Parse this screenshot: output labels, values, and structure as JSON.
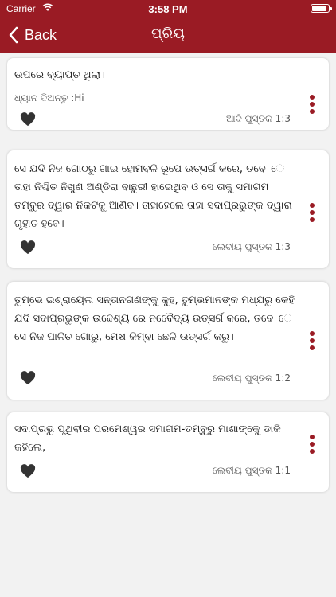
{
  "status_bar": {
    "carrier": "Carrier",
    "time": "3:58 PM"
  },
  "nav": {
    "back_label": "Back",
    "title": "ପ୍ରିୟ"
  },
  "cards": [
    {
      "text": "ଉପରେ ବ୍ୟାପ୍ତ ଥିଲା।",
      "note": "ଧ୍ୟାନ ଦିଅନ୍ତୁ :Hi",
      "ref": "ଆଦି ପୁସ୍ତକ 1:3"
    },
    {
      "text": " ସେ ଯଦି ନିଜ ଗୋଠରୁ ଗାଇ ହୋମବଳି ରୂପେ ଉତ୍ସର୍ଗ କରେ, ତବେ େ ତାହା ନିଶ୍ଚିତ ନିଖୁଣ ଅଣ୍ଡିରା ବାଛୁରୀ ହାଇେଥିବ ଓ ସେ ତାକୁ ସମାଗମ ତମ୍ବୁର ଦ୍ୱାର ନିକଟକୁ ଆଣିବ। ତାହାହେଲେ ତାହା ସଦାପ୍ରଭୁଙ୍କ ଦ୍ୱାରା ଗୃହୀତ ହବେ।",
      "ref": "ଲେବୀୟ ପୁସ୍ତକ 1:3"
    },
    {
      "text": "ତୁମ୍ଭେ ଇଶ୍ରାୟେଲ ସନ୍ତାନଗଣଙ୍କୁ କୁହ, ତୁମ୍ଭମାନଙ୍କ ମଧ୍ଯରୁ କେହି ଯଦି ସଦାପ୍ରଭୁଙ୍କ ଉଦ୍ଦେଶ୍ୟ ରେ ନବୈେଦ୍ୟ ଉତ୍ସର୍ଗ କରେ, ତବେ େ ସେ ନିଜ ପାଳିତ ଗୋରୁ, ମେଷ କିମ୍ବା ଛେଳି ଉତ୍ସର୍ଗ କରୁ।",
      "ref": "ଲେବୀୟ ପୁସ୍ତକ 1:2"
    },
    {
      "text": "ସଦାପ୍ରଭୁ ପୃଥିବୀର ପରମେଶ୍ୱର ସମାଗମ-ତମ୍ବୁରୁ ମାଶାଙ୍କେୁ ଡାକି କହିଲେ,",
      "ref": "ଲେବୀୟ ପୁସ୍ତକ 1:1"
    }
  ],
  "colors": {
    "accent": "#9a1b24",
    "background": "#f2f2f2",
    "card": "#ffffff"
  },
  "icons": {
    "back": "chevron-left-icon",
    "favorite": "heart-icon",
    "menu": "more-vertical-icon",
    "wifi": "wifi-icon",
    "battery": "battery-icon"
  },
  "battery_level": 0.9
}
